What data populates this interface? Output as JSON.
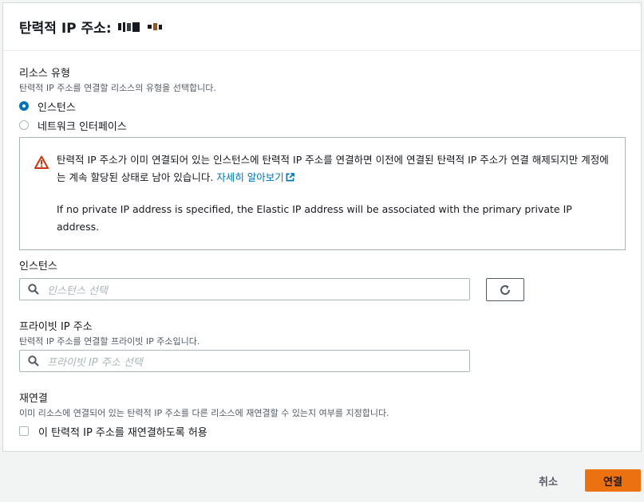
{
  "header": {
    "title": "탄력적 IP 주소:"
  },
  "resource_type": {
    "label": "리소스 유형",
    "description": "탄력적 IP 주소를 연결할 리소스의 유형을 선택합니다.",
    "options": [
      {
        "label": "인스턴스",
        "checked": true
      },
      {
        "label": "네트워크 인터페이스",
        "checked": false
      }
    ]
  },
  "alert": {
    "warning_text": "탄력적 IP 주소가 이미 연결되어 있는 인스턴스에 탄력적 IP 주소를 연결하면 이전에 연결된 탄력적 IP 주소가 연결 해제되지만 계정에는 계속 할당된 상태로 남아 있습니다.",
    "link_text": "자세히 알아보기",
    "info_text": "If no private IP address is specified, the Elastic IP address will be associated with the primary private IP address.",
    "icon": "warning-icon",
    "icon_color": "#d13212"
  },
  "instance": {
    "label": "인스턴스",
    "placeholder": "인스턴스 선택"
  },
  "private_ip": {
    "label": "프라이빗 IP 주소",
    "description": "탄력적 IP 주소를 연결할 프라이빗 IP 주소입니다.",
    "placeholder": "프라이빗 IP 주소 선택"
  },
  "reassociation": {
    "label": "재연결",
    "description": "이미 리소스에 연결되어 있는 탄력적 IP 주소를 다른 리소스에 재연결할 수 있는지 여부를 지정합니다.",
    "checkbox_label": "이 탄력적 IP 주소를 재연결하도록 허용",
    "checked": false
  },
  "footer": {
    "cancel_label": "취소",
    "connect_label": "연결",
    "accent_color": "#ec7211"
  }
}
